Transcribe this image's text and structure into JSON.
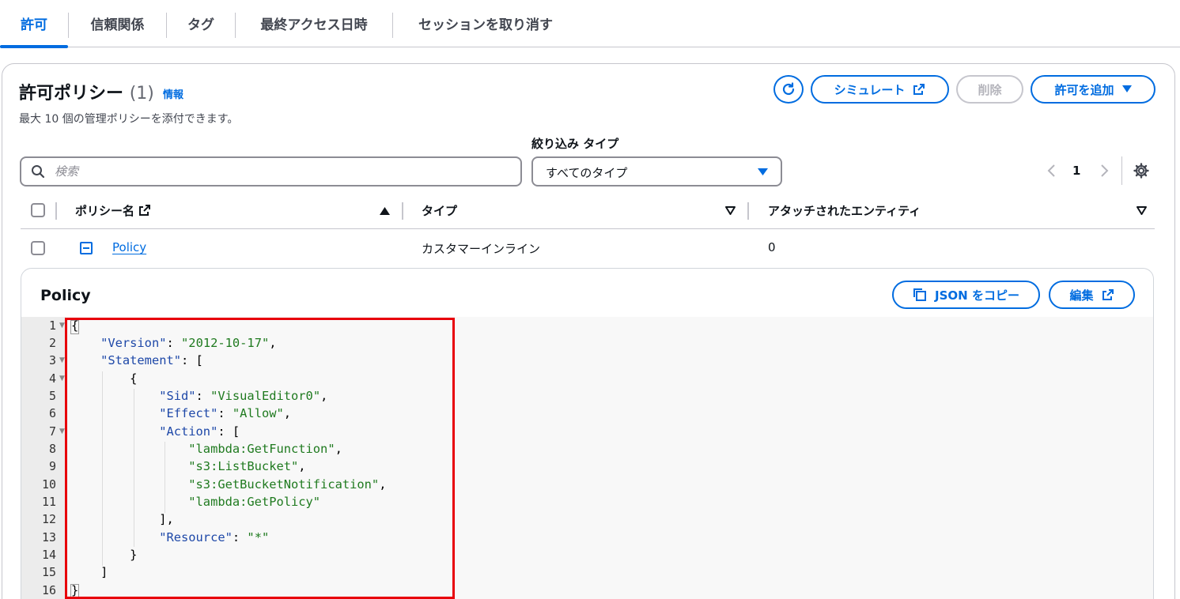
{
  "tabs": [
    {
      "label": "許可",
      "active": true
    },
    {
      "label": "信頼関係"
    },
    {
      "label": "タグ"
    },
    {
      "label": "最終アクセス日時"
    },
    {
      "label": "セッションを取り消す"
    }
  ],
  "header": {
    "title": "許可ポリシー",
    "count": "(1)",
    "info": "情報",
    "subtitle": "最大 10 個の管理ポリシーを添付できます。"
  },
  "buttons": {
    "simulate": "シミュレート",
    "delete": "削除",
    "add_permission": "許可を追加",
    "copy_json": "JSON をコピー",
    "edit": "編集"
  },
  "filter": {
    "search_placeholder": "検索",
    "type_label": "絞り込み タイプ",
    "type_value": "すべてのタイプ"
  },
  "pagination": {
    "page": "1"
  },
  "table": {
    "columns": [
      "ポリシー名",
      "タイプ",
      "アタッチされたエンティティ"
    ],
    "rows": [
      {
        "name": "Policy",
        "type": "カスタマーインライン",
        "entities": "0"
      }
    ]
  },
  "policy": {
    "title": "Policy",
    "line_numbers": [
      "1",
      "2",
      "3",
      "4",
      "5",
      "6",
      "7",
      "8",
      "9",
      "10",
      "11",
      "12",
      "13",
      "14",
      "15",
      "16"
    ],
    "keys": {
      "version": "\"Version\"",
      "statement": "\"Statement\"",
      "sid": "\"Sid\"",
      "effect": "\"Effect\"",
      "action": "\"Action\"",
      "resource": "\"Resource\""
    },
    "values": {
      "version": "\"2012-10-17\"",
      "sid": "\"VisualEditor0\"",
      "effect": "\"Allow\"",
      "resource": "\"*\""
    },
    "actions": [
      "\"lambda:GetFunction\"",
      "\"s3:ListBucket\"",
      "\"s3:GetBucketNotification\"",
      "\"lambda:GetPolicy\""
    ]
  },
  "colors": {
    "accent": "#006ce0",
    "highlight": "#e8000b",
    "json_key": "#1e48a8",
    "json_string": "#1f7a1f"
  }
}
